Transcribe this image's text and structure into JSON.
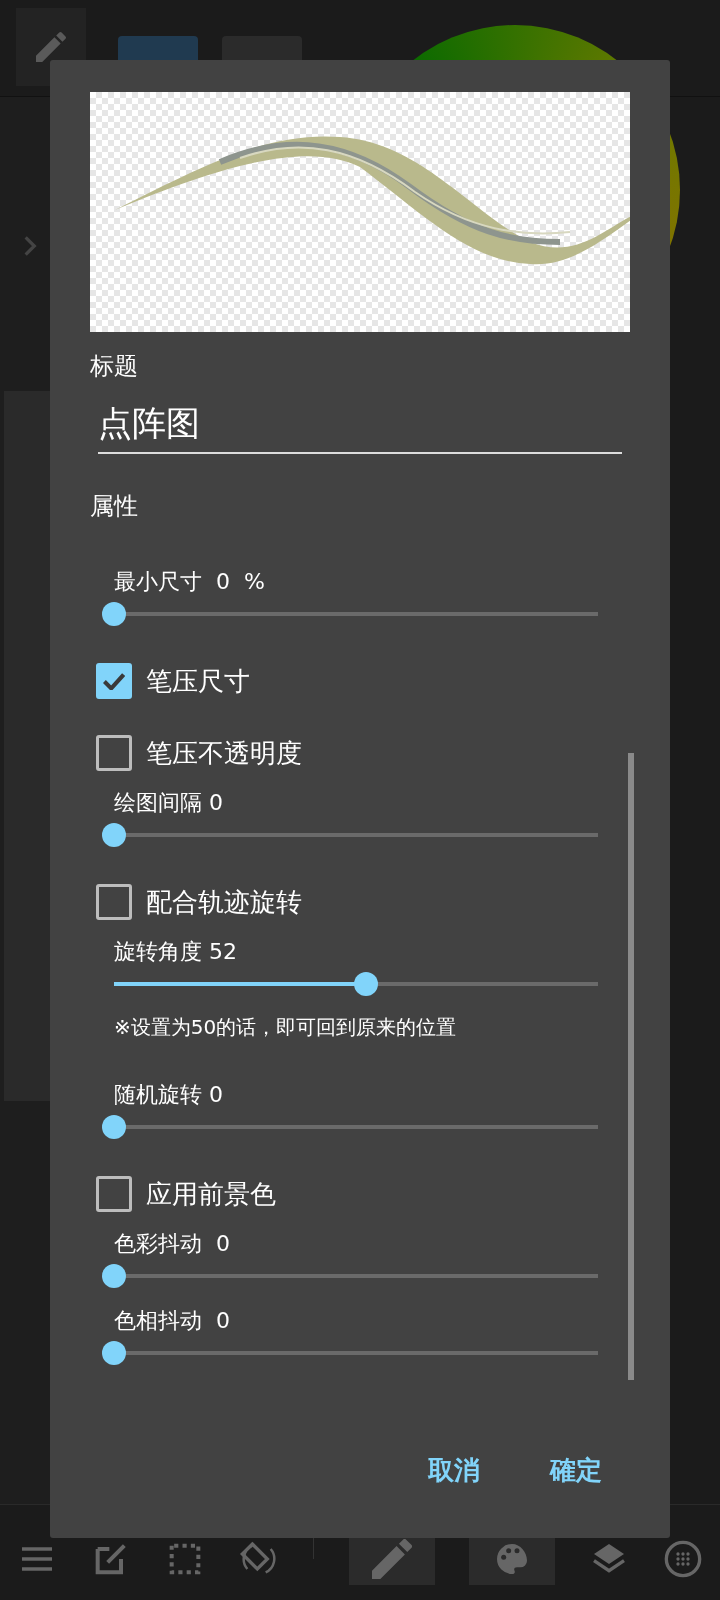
{
  "dialog": {
    "title_label": "标题",
    "title_value": "点阵图",
    "section": "属性",
    "items": [
      {
        "kind": "slider",
        "label": "最小尺寸  0  %",
        "level": 0
      },
      {
        "kind": "checkbox",
        "label": "笔压尺寸",
        "checked": true
      },
      {
        "kind": "checkbox",
        "label": "笔压不透明度",
        "checked": false
      },
      {
        "kind": "slider",
        "label": "绘图间隔 0",
        "level": 0
      },
      {
        "kind": "checkbox",
        "label": "配合轨迹旋转",
        "checked": false
      },
      {
        "kind": "slider",
        "label": "旋转角度 52",
        "level": 0.52
      },
      {
        "kind": "note",
        "label": "※设置为50的话，即可回到原来的位置"
      },
      {
        "kind": "slider",
        "label": "随机旋转 0",
        "level": 0
      },
      {
        "kind": "checkbox",
        "label": "应用前景色",
        "checked": false
      },
      {
        "kind": "slider",
        "label": "色彩抖动  0",
        "level": 0
      },
      {
        "kind": "slider",
        "label": "色相抖动  0",
        "level": 0
      }
    ],
    "buttons": [
      "取消",
      "確定"
    ]
  }
}
